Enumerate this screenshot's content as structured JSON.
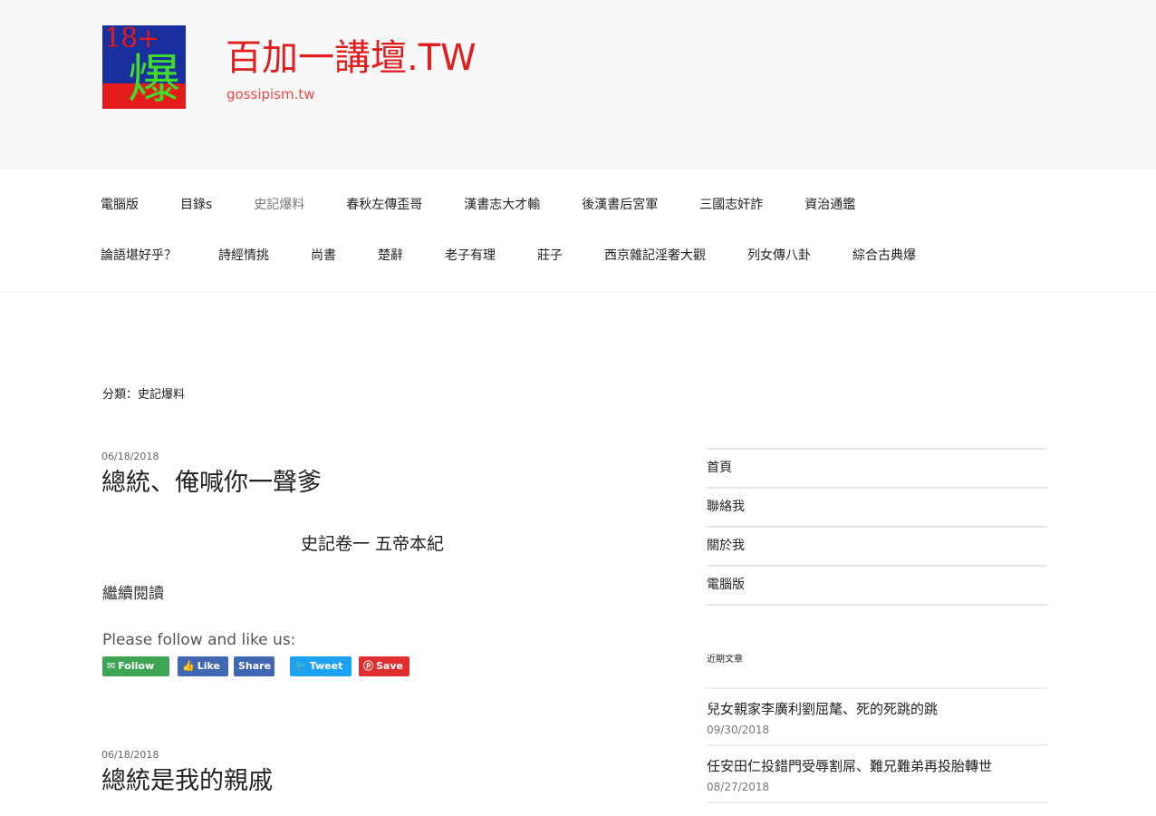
{
  "header": {
    "logo": {
      "number": "18+",
      "glyph": "爆"
    },
    "title": "百加一講壇.TW",
    "description": "gossipism.tw"
  },
  "nav": {
    "row1": [
      "電腦版",
      "目錄s",
      "史記爆料",
      "春秋左傳歪哥",
      "漢書志大才輸",
      "後漢書后宮軍",
      "三國志奸詐",
      "資治通鑑"
    ],
    "row2": [
      "論語堪好乎？",
      "詩經情挑",
      "尚書",
      "楚辭",
      "老子有理",
      "莊子",
      "西京雜記淫奢大觀",
      "列女傳八卦",
      "綜合古典爆"
    ],
    "active": "史記爆料"
  },
  "category": "分類：史記爆料",
  "posts": [
    {
      "date": "06/18/2018",
      "title": "總統、俺喊你一聲爹",
      "excerpt": "史記卷一 五帝本紀",
      "more": "繼續閱讀"
    },
    {
      "date": "06/18/2018",
      "title": "總統是我的親戚"
    }
  ],
  "social": {
    "follow_text": "Please follow and like us:",
    "buttons": [
      {
        "label": "Follow",
        "icon": "mail-icon",
        "color": "#3ea555"
      },
      {
        "label": "Like",
        "icon": "thumbs-up-icon",
        "color": "#4267b2"
      },
      {
        "label": "Share",
        "icon": "share-icon",
        "color": "#4267b2"
      },
      {
        "label": "Tweet",
        "icon": "twitter-icon",
        "color": "#1da1f2"
      },
      {
        "label": "Save",
        "icon": "pinterest-icon",
        "color": "#e02d2d"
      }
    ]
  },
  "sidebar": {
    "links": [
      "首頁",
      "聯絡我",
      "關於我",
      "電腦版"
    ],
    "recent_heading": "近期文章",
    "recent": [
      {
        "title": "兒女親家李廣利劉屈氂、死的死跳的跳",
        "date": "09/30/2018"
      },
      {
        "title": "任安田仁投錯門受辱割屌、難兄難弟再投胎轉世",
        "date": "08/27/2018"
      }
    ]
  }
}
